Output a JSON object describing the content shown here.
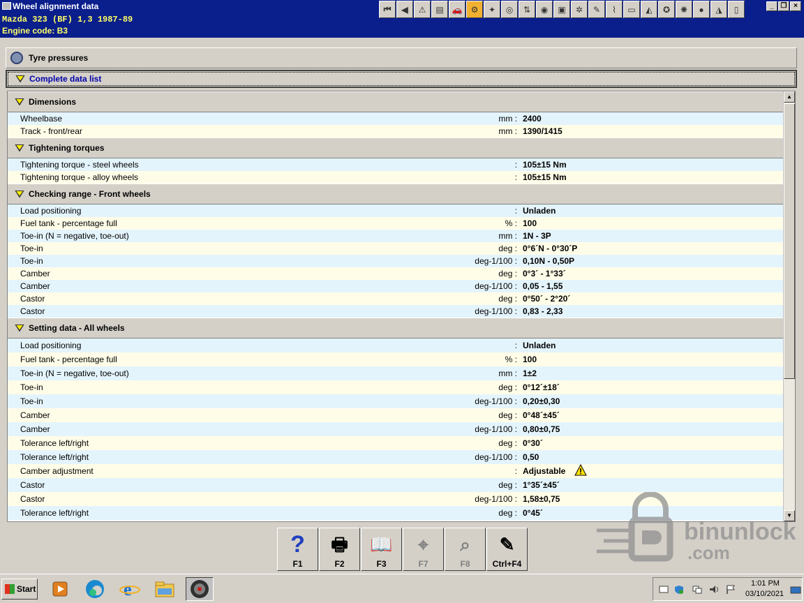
{
  "window": {
    "title": "Wheel alignment data",
    "vehicle": "Mazda   323 (BF) 1,3   1987-89",
    "engine": "Engine code: B3"
  },
  "toolbar": {
    "icons": [
      "first-icon",
      "prev-icon",
      "warning-icon",
      "document-icon",
      "vehicle-info-icon",
      "service-icon",
      "wheel-tool-icon",
      "tyre-icon",
      "lift-icon",
      "brake-icon",
      "engine-icon",
      "gear-icon",
      "spanner-icon",
      "suspension-icon",
      "battery-icon",
      "car-icon",
      "steering-icon",
      "valve-icon",
      "globe-icon",
      "car-body-icon",
      "parts-icon"
    ]
  },
  "topbars": {
    "tyre_pressures": "Tyre pressures",
    "complete_data_list": "Complete data list"
  },
  "sections": [
    {
      "title": "Dimensions",
      "rows": [
        {
          "label": "Wheelbase",
          "unit": "mm :",
          "value": "2400"
        },
        {
          "label": "Track - front/rear",
          "unit": "mm :",
          "value": "1390/1415"
        }
      ]
    },
    {
      "title": "Tightening torques",
      "rows": [
        {
          "label": "Tightening torque - steel wheels",
          "unit": ":",
          "value": "105±15 Nm"
        },
        {
          "label": "Tightening torque - alloy wheels",
          "unit": ":",
          "value": "105±15 Nm"
        }
      ]
    },
    {
      "title": "Checking range - Front wheels",
      "rows": [
        {
          "label": "Load positioning",
          "unit": ":",
          "value": "Unladen"
        },
        {
          "label": "Fuel tank - percentage full",
          "unit": "% :",
          "value": "100"
        },
        {
          "label": "Toe-in (N = negative, toe-out)",
          "unit": "mm :",
          "value": "1N - 3P"
        },
        {
          "label": "Toe-in",
          "unit": "deg :",
          "value": "0°6´N - 0°30´P"
        },
        {
          "label": "Toe-in",
          "unit": "deg-1/100 :",
          "value": "0,10N - 0,50P"
        },
        {
          "label": "Camber",
          "unit": "deg :",
          "value": "0°3´ - 1°33´"
        },
        {
          "label": "Camber",
          "unit": "deg-1/100 :",
          "value": "0,05 - 1,55"
        },
        {
          "label": "Castor",
          "unit": "deg :",
          "value": "0°50´ - 2°20´"
        },
        {
          "label": "Castor",
          "unit": "deg-1/100 :",
          "value": "0,83 - 2,33"
        }
      ]
    },
    {
      "title": "Setting data - All wheels",
      "rows": [
        {
          "label": "Load positioning",
          "unit": ":",
          "value": "Unladen"
        },
        {
          "label": "Fuel tank - percentage full",
          "unit": "% :",
          "value": "100"
        },
        {
          "label": "Toe-in (N = negative, toe-out)",
          "unit": "mm :",
          "value": "1±2"
        },
        {
          "label": "Toe-in",
          "unit": "deg :",
          "value": "0°12´±18´"
        },
        {
          "label": "Toe-in",
          "unit": "deg-1/100 :",
          "value": "0,20±0,30"
        },
        {
          "label": "Camber",
          "unit": "deg :",
          "value": "0°48´±45´"
        },
        {
          "label": "Camber",
          "unit": "deg-1/100 :",
          "value": "0,80±0,75"
        },
        {
          "label": "Tolerance left/right",
          "unit": "deg :",
          "value": "0°30´"
        },
        {
          "label": "Tolerance left/right",
          "unit": "deg-1/100 :",
          "value": "0,50"
        },
        {
          "label": "Camber adjustment",
          "unit": ":",
          "value": "Adjustable",
          "warning": true
        },
        {
          "label": "Castor",
          "unit": "deg :",
          "value": "1°35´±45´"
        },
        {
          "label": "Castor",
          "unit": "deg-1/100 :",
          "value": "1,58±0,75"
        },
        {
          "label": "Tolerance left/right",
          "unit": "deg :",
          "value": "0°45´"
        }
      ]
    }
  ],
  "fkeys": [
    {
      "label": "F1",
      "icon": "help-icon",
      "enabled": true
    },
    {
      "label": "F2",
      "icon": "printer-icon",
      "enabled": true
    },
    {
      "label": "F3",
      "icon": "book-icon",
      "enabled": true
    },
    {
      "label": "F7",
      "icon": "target-icon",
      "enabled": false
    },
    {
      "label": "F8",
      "icon": "dictionary-icon",
      "enabled": false
    },
    {
      "label": "Ctrl+F4",
      "icon": "notepad-icon",
      "enabled": true
    }
  ],
  "watermark": {
    "line1": "binunlock",
    "line2": ".com"
  },
  "taskbar": {
    "start_label": "Start",
    "time": "1:01 PM",
    "date": "03/10/2021"
  },
  "colors": {
    "titlebar": "#0a1e8c",
    "vehicle_text": "#ffff66",
    "row_even": "#e4f4fc",
    "row_odd": "#fffde8",
    "link_blue": "#0000aa"
  }
}
